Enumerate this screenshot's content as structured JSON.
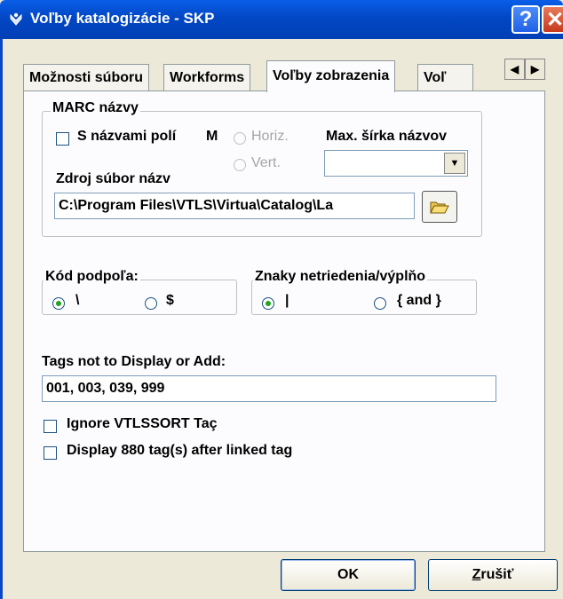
{
  "window": {
    "title": "Voľby katalogizácie - SKP",
    "help": "?",
    "close": "✕"
  },
  "tabs": [
    "Možnosti súboru",
    "Workforms",
    "Voľby zobrazenia",
    "Voľ"
  ],
  "marc": {
    "legend": "MARC názvy",
    "with_field_names": "S názvami polí",
    "with_field_names_overflow": "M",
    "horiz": "Horiz.",
    "vert": "Vert.",
    "max_width_label": "Max. šírka názvov",
    "max_width_value": "",
    "source_label": "Zdroj súbor názv",
    "source_path": "C:\\Program Files\\VTLS\\Virtua\\Catalog\\La"
  },
  "subfield": {
    "legend": "Kód podpoľa:",
    "opt1": "\\",
    "opt2": "$"
  },
  "nonfiling": {
    "legend": "Znaky netriedenia/výplňo",
    "opt1": "|",
    "opt2": "{ and }"
  },
  "tags": {
    "label": "Tags not to Display or Add:",
    "value": "001, 003, 039, 999"
  },
  "options": {
    "ignore_sort": "Ignore VTLSSORT Taç",
    "display_880": "Display 880 tag(s) after linked tag"
  },
  "buttons": {
    "ok": "OK",
    "cancel_first": "Z",
    "cancel_rest": "rušiť"
  },
  "colors": {
    "titlebar": "#0247c4",
    "dialog": "#ece9d8",
    "panel": "#fcfcfe"
  }
}
